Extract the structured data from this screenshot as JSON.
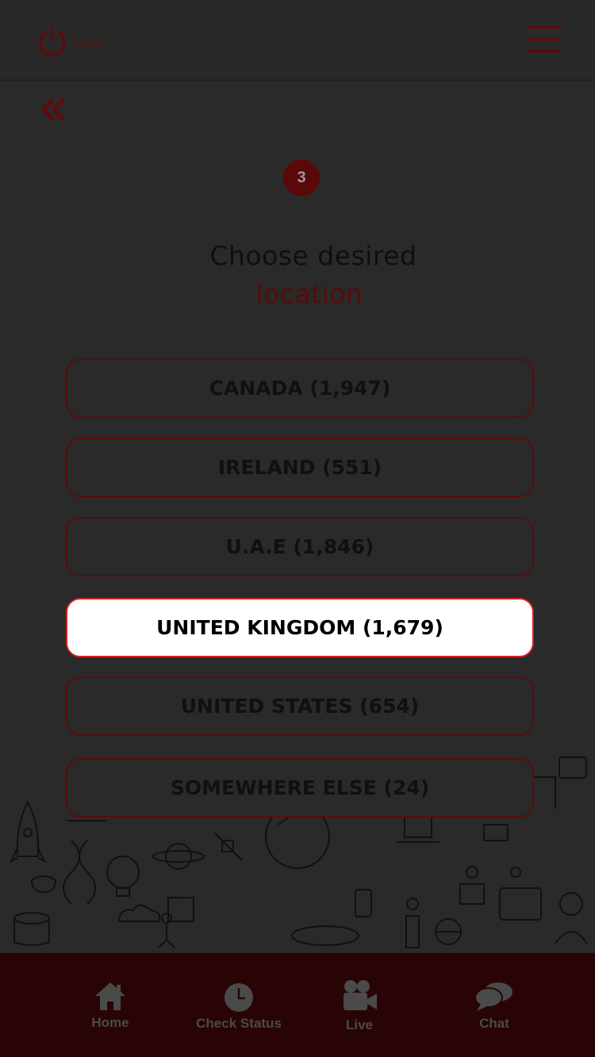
{
  "header": {
    "logout_label": "Logout"
  },
  "step": {
    "number": "3"
  },
  "title": {
    "line1": "Choose desired",
    "line2": "location"
  },
  "locations": [
    {
      "label": "CANADA (1,947)",
      "selected": false
    },
    {
      "label": "IRELAND (551)",
      "selected": false
    },
    {
      "label": "U.A.E (1,846)",
      "selected": false
    },
    {
      "label": "UNITED KINGDOM (1,679)",
      "selected": true
    },
    {
      "label": "UNITED STATES (654)",
      "selected": false
    },
    {
      "label": "SOMEWHERE ELSE (24)",
      "selected": false
    }
  ],
  "bottom_nav": {
    "items": [
      {
        "label": "Home",
        "icon": "home-icon"
      },
      {
        "label": "Check Status",
        "icon": "clock-icon"
      },
      {
        "label": "Live",
        "icon": "video-camera-icon"
      },
      {
        "label": "Chat",
        "icon": "chat-bubbles-icon"
      }
    ]
  },
  "colors": {
    "accent": "#d61e1e",
    "overlay_dark": "#2a2a2a",
    "nav_bg": "#290406"
  }
}
